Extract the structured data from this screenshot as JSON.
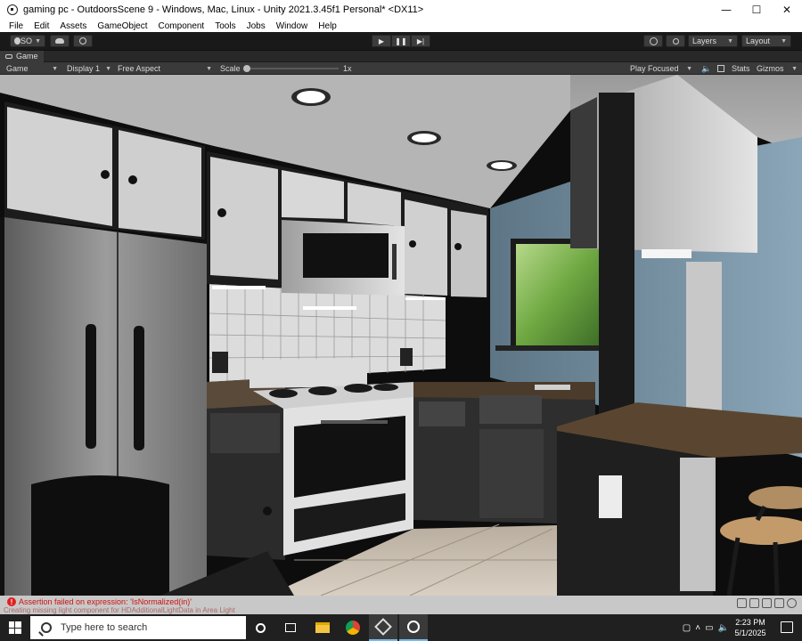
{
  "window": {
    "title": "gaming pc - OutdoorsScene 9 - Windows, Mac, Linux - Unity 2021.3.45f1 Personal* <DX11>",
    "minimize": "—",
    "maximize": "☐",
    "close": "✕"
  },
  "menu": [
    "File",
    "Edit",
    "Assets",
    "GameObject",
    "Component",
    "Tools",
    "Jobs",
    "Window",
    "Help"
  ],
  "toolbar": {
    "account_label": "SO",
    "layers_label": "Layers",
    "layout_label": "Layout"
  },
  "game_tab": {
    "label": "Game"
  },
  "game_controls": {
    "mode": "Game",
    "display": "Display 1",
    "aspect": "Free Aspect",
    "scale_label": "Scale",
    "scale_value": "1x",
    "play_mode": "Play Focused",
    "stats_label": "Stats",
    "gizmos_label": "Gizmos"
  },
  "console": {
    "message": "Assertion failed on expression: 'IsNormalized(in)'",
    "secondary": "Creating missing light component for HDAdditionalLightData in Area Light"
  },
  "taskbar": {
    "search_placeholder": "Type here to search",
    "time": "2:23 PM",
    "date": "5/1/2025"
  },
  "colors": {
    "titlebar": "#ffffff",
    "editor_bg": "#282828",
    "error": "#d01010",
    "taskbar": "#202020",
    "accent": "#76b9ed"
  }
}
